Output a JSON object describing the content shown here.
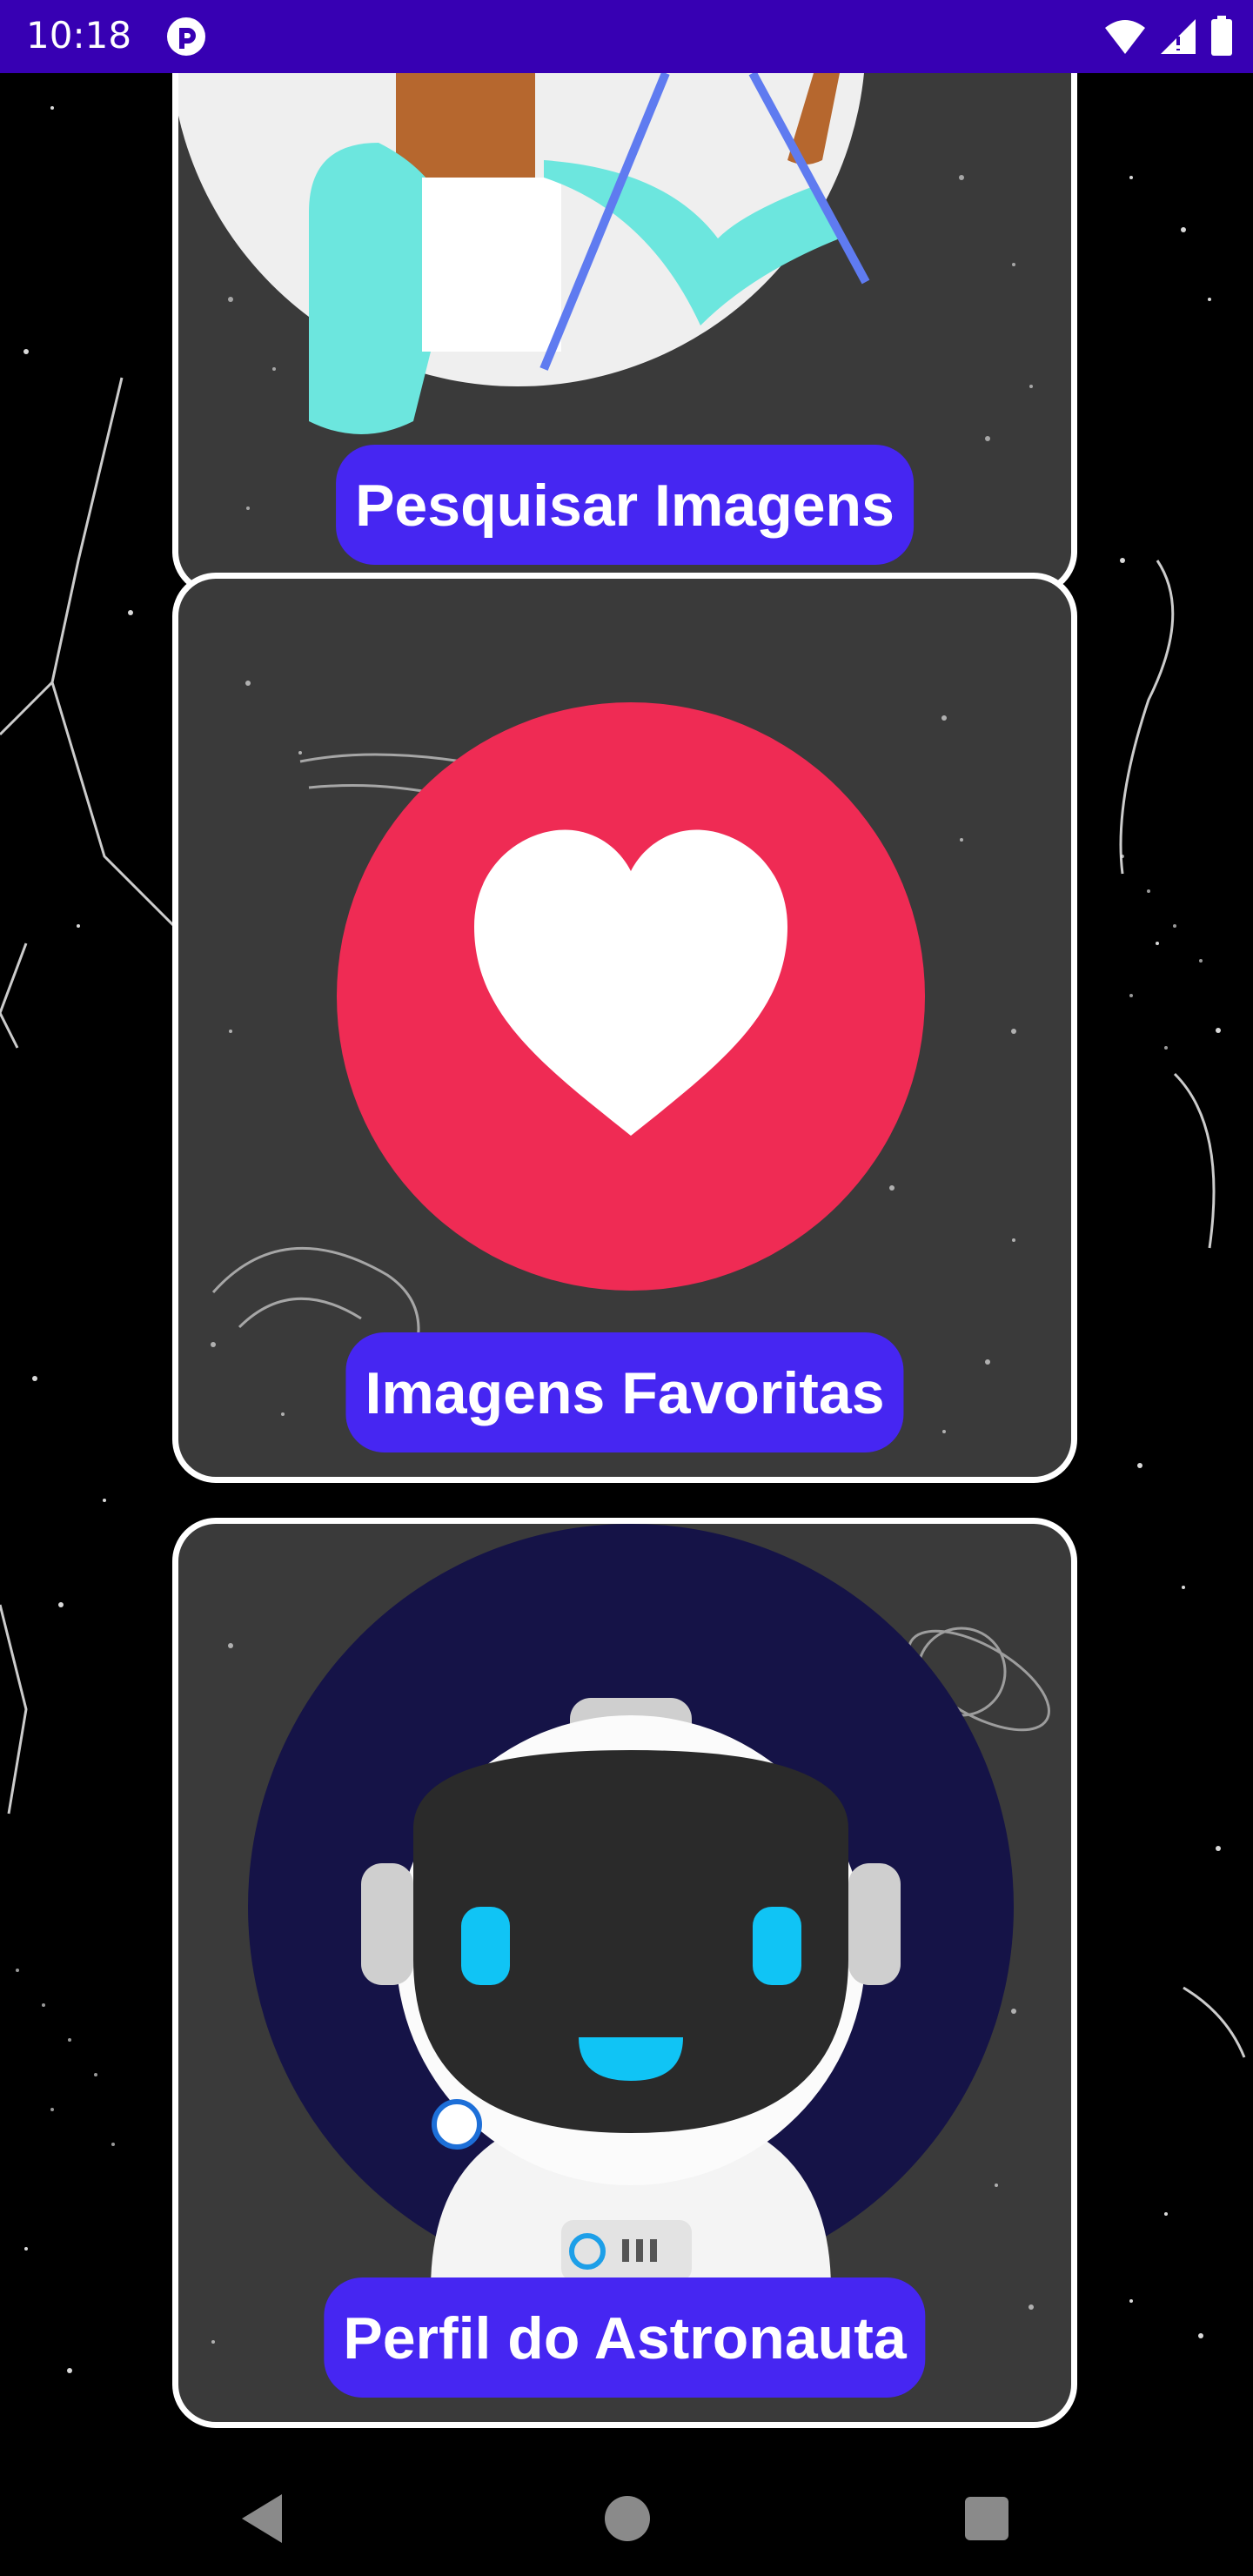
{
  "status_bar": {
    "time": "10:18",
    "background": "#3700b3",
    "icons": [
      "app-notification-icon",
      "wifi-icon",
      "signal-icon",
      "battery-icon"
    ]
  },
  "cards": [
    {
      "label": "Pesquisar Imagens",
      "icon": "search-person-illustration"
    },
    {
      "label": "Imagens Favoritas",
      "icon": "heart-icon"
    },
    {
      "label": "Perfil do Astronauta",
      "icon": "astronaut-avatar"
    }
  ],
  "colors": {
    "accent": "#4626f2",
    "heart_circle": "#ef2b54",
    "astronaut_bg": "#151347"
  },
  "nav_bar": {
    "buttons": [
      "back-icon",
      "home-icon",
      "recents-icon"
    ]
  }
}
